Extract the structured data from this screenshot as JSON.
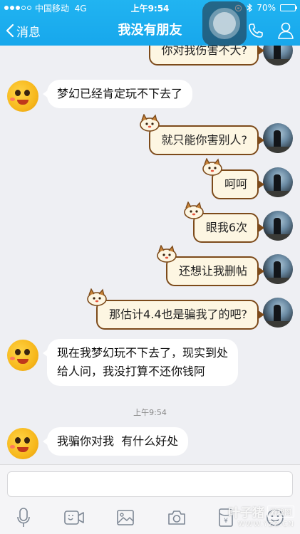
{
  "status_bar": {
    "signal_strength": 3,
    "carrier": "中国移动",
    "network": "4G",
    "time": "上午9:54",
    "battery_text": "70%",
    "battery_level": 0.7
  },
  "nav": {
    "back_label": "消息",
    "title": "我没有朋友"
  },
  "messages": [
    {
      "direction": "out",
      "text": "你对我伤害不大?"
    },
    {
      "direction": "in",
      "text": "梦幻已经肯定玩不下去了"
    },
    {
      "direction": "out",
      "text": "就只能你害别人?"
    },
    {
      "direction": "out",
      "text": "呵呵"
    },
    {
      "direction": "out",
      "text": "眼我6次"
    },
    {
      "direction": "out",
      "text": "还想让我删帖"
    },
    {
      "direction": "out",
      "text": "那估计4.4也是骗我了的吧?"
    },
    {
      "direction": "in",
      "text_line1": "现在我梦幻玩不下去了，现实到处",
      "text_line2": "给人问，我没打算不还你钱阿"
    },
    {
      "direction": "in",
      "text": "我骗你对我  有什么好处"
    }
  ],
  "time_divider": "上午9:54",
  "input": {
    "placeholder": ""
  },
  "toolbar": {
    "icons": [
      "microphone-icon",
      "video-icon",
      "image-icon",
      "camera-icon",
      "red-packet-icon",
      "emoji-icon"
    ]
  },
  "watermark": {
    "main": "叶子猪",
    "box": "游戏网",
    "url": "WWW.YZZ.CN"
  },
  "colors": {
    "nav_bar": "#18a9ee",
    "chat_bg": "#eeeff3",
    "bubble_out_bg": "#fdf6e2",
    "bubble_out_border": "#7c4a1a",
    "bubble_in_bg": "#ffffff"
  }
}
